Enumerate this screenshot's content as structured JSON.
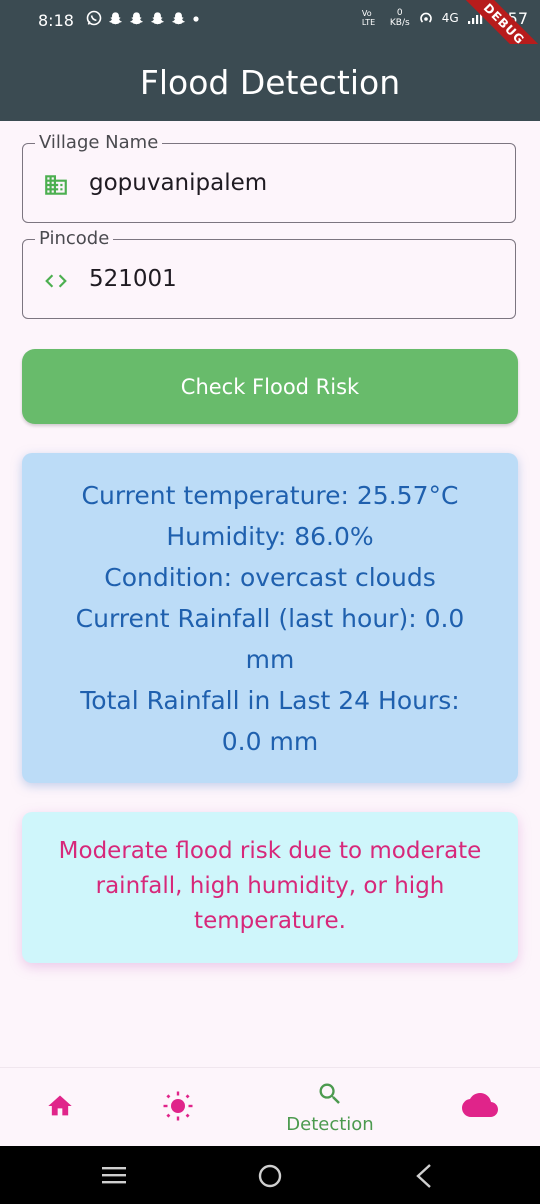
{
  "status_bar": {
    "time": "8:18",
    "network_type": "4G",
    "data_rate_value": "0",
    "data_rate_unit": "KB/s",
    "volte": "Vo LTE",
    "battery_level": "57",
    "debug_label": "DEBUG"
  },
  "app_bar": {
    "title": "Flood Detection"
  },
  "form": {
    "village": {
      "label": "Village Name",
      "value": "gopuvanipalem",
      "icon": "building-icon"
    },
    "pincode": {
      "label": "Pincode",
      "value": "521001",
      "icon": "code-icon"
    },
    "submit_label": "Check Flood Risk"
  },
  "weather": {
    "lines": [
      "Current temperature: 25.57°C",
      "Humidity: 86.0%",
      "Condition: overcast clouds",
      "Current Rainfall (last hour): 0.0",
      "mm",
      "Total Rainfall in Last 24 Hours:",
      "0.0 mm"
    ]
  },
  "risk": {
    "lines": [
      "Moderate flood risk due to moderate",
      "rainfall, high humidity, or high",
      "temperature."
    ]
  },
  "bottom_nav": {
    "items": [
      {
        "icon": "home-icon",
        "label": ""
      },
      {
        "icon": "sun-icon",
        "label": ""
      },
      {
        "icon": "search-icon",
        "label": "Detection",
        "active": true
      },
      {
        "icon": "cloud-icon",
        "label": ""
      }
    ]
  },
  "colors": {
    "app_bar": "#3b4b52",
    "accent_green": "#68bb6b",
    "weather_card": "#bcdcf7",
    "weather_text": "#1f60ae",
    "risk_card": "#cff6fb",
    "risk_text": "#d7287a",
    "nav_pink": "#e0248a"
  }
}
